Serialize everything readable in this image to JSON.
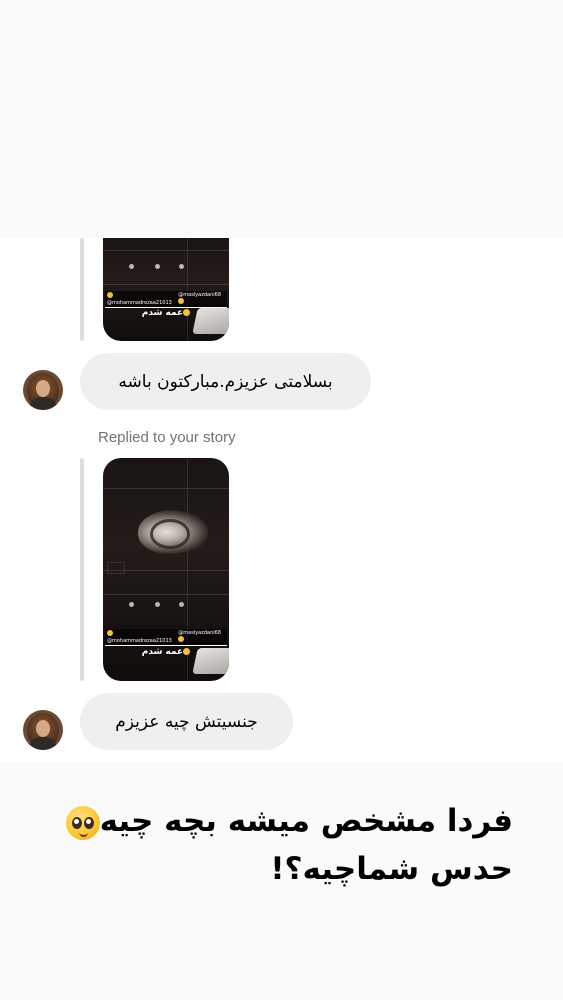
{
  "thread": {
    "messages": [
      {
        "type": "story_reply",
        "story": {
          "mention_left": "@mohammadrezaa21013",
          "mention_right": "@maslyazdani68",
          "caption": "عمه شدم"
        },
        "reply_text": "بسلامتی عزیزم.مبارکتون باشه"
      },
      {
        "type": "story_reply",
        "label": "Replied to your story",
        "story": {
          "mention_left": "@mohammadrezaa21013",
          "mention_right": "@maslyazdani68",
          "caption": "عمه شدم"
        },
        "reply_text": "جنسیتش چیه عزیزم"
      }
    ]
  },
  "overlay_caption": {
    "line1": "فردا مشخص میشه بچه چیه",
    "line1_emoji": "pleading-face-icon",
    "line2": "حدس شماچیه؟!"
  },
  "colors": {
    "bubble": "#efefef",
    "muted_text": "#737373",
    "band": "#fafafa"
  }
}
